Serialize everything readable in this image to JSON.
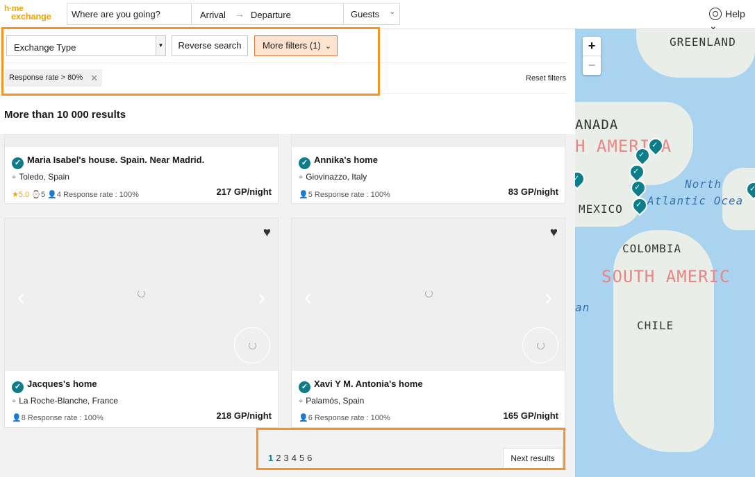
{
  "header": {
    "logo_line1": "h·me",
    "logo_line2": "exchange",
    "search_placeholder": "Where are you going?",
    "arrival": "Arrival",
    "arrow": "→",
    "departure": "Departure",
    "guests": "Guests",
    "help": "Help"
  },
  "filters": {
    "exchange_type": "Exchange Type",
    "reverse_search": "Reverse search",
    "more_filters": "More filters (1)",
    "active_tag": "Response rate > 80%",
    "reset": "Reset filters"
  },
  "results": {
    "count": "More than 10 000 results",
    "cards": [
      {
        "title": "Maria Isabel's house. Spain. Near Madrid.",
        "location": "Toledo, Spain",
        "rating": "5.0",
        "reviews": "5",
        "guests": "4",
        "response": "Response rate : 100%",
        "price": "217 GP/night"
      },
      {
        "title": "Annika's home",
        "location": "Giovinazzo, Italy",
        "guests": "5",
        "response": "Response rate : 100%",
        "price": "83 GP/night"
      },
      {
        "title": "Jacques's home",
        "location": "La Roche-Blanche, France",
        "guests": "8",
        "response": "Response rate : 100%",
        "price": "218 GP/night"
      },
      {
        "title": "Xavi Y M. Antonia's home",
        "location": "Palamós, Spain",
        "guests": "6",
        "response": "Response rate : 100%",
        "price": "165 GP/night"
      }
    ]
  },
  "pagination": {
    "pages": [
      "1",
      "2",
      "3",
      "4",
      "5",
      "6"
    ],
    "next": "Next results"
  },
  "map": {
    "zoom_in": "+",
    "zoom_out": "−",
    "labels": {
      "greenland": "GREENLAND",
      "canada": "ANADA",
      "north_america": "H AMERICA",
      "north_ocean_1": "North",
      "north_ocean_2": "Atlantic Ocea",
      "mexico": "MEXICO",
      "colombia": "COLOMBIA",
      "south_america": "SOUTH AMERIC",
      "chile": "CHILE",
      "pacific": "an"
    }
  }
}
